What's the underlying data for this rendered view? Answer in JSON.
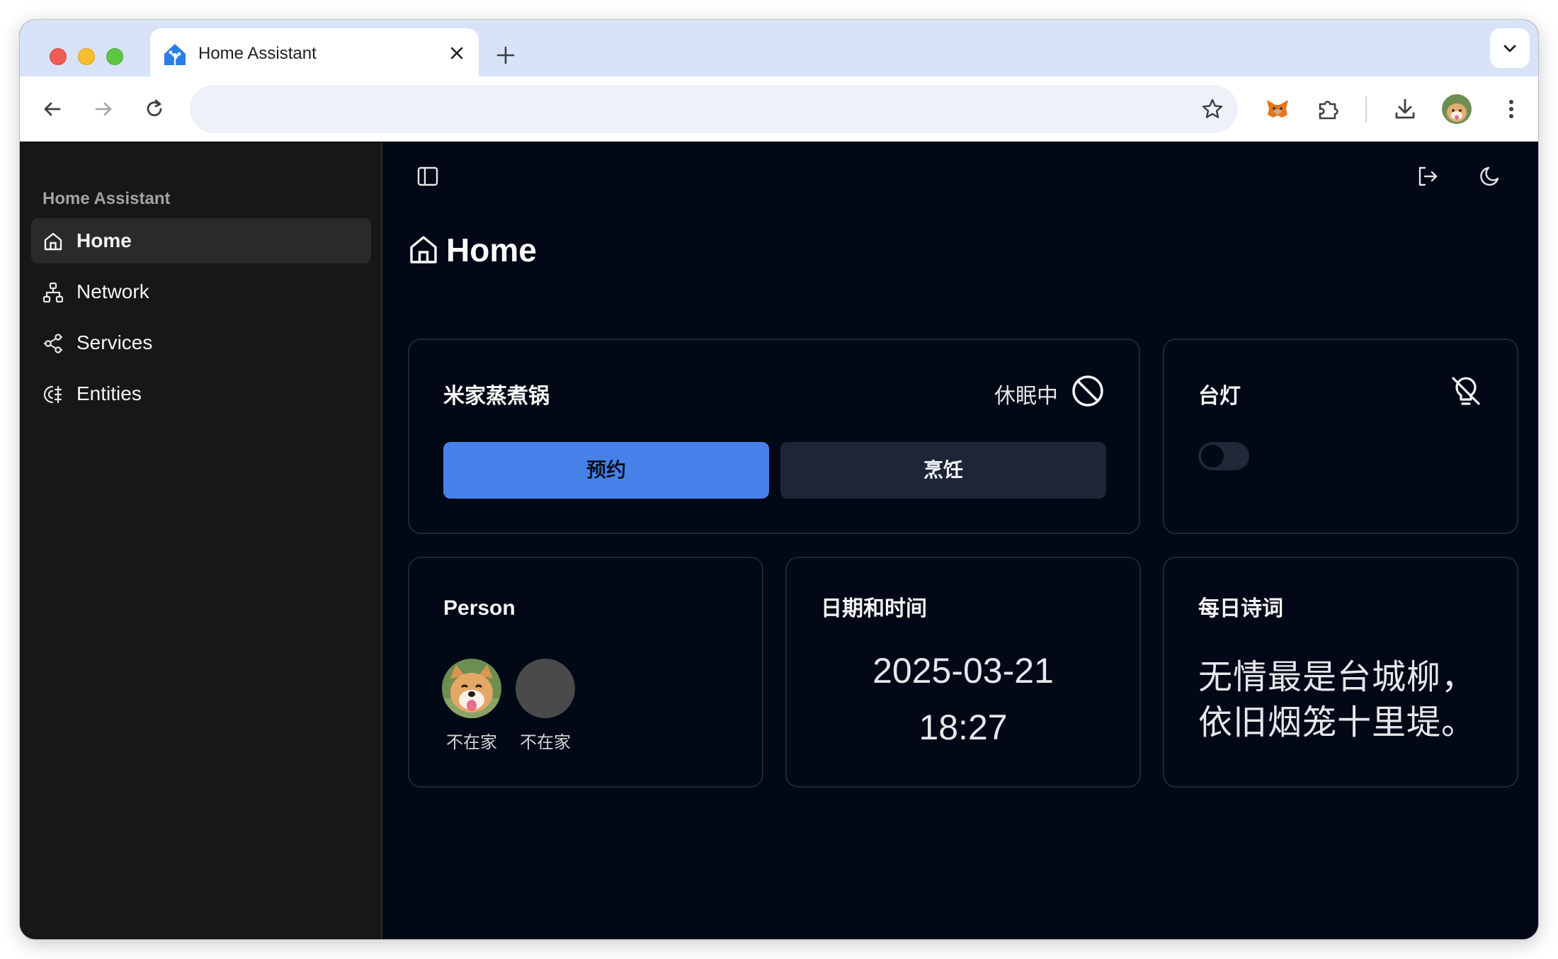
{
  "browser": {
    "tab_title": "Home Assistant",
    "address": ""
  },
  "sidebar": {
    "title": "Home Assistant",
    "items": [
      {
        "label": "Home",
        "icon": "home-icon",
        "active": true
      },
      {
        "label": "Network",
        "icon": "network-icon",
        "active": false
      },
      {
        "label": "Services",
        "icon": "services-icon",
        "active": false
      },
      {
        "label": "Entities",
        "icon": "entities-icon",
        "active": false
      }
    ]
  },
  "page": {
    "title": "Home"
  },
  "cards": {
    "cooker": {
      "title": "米家蒸煮锅",
      "status": "休眠中",
      "button_schedule": "预约",
      "button_cook": "烹饪"
    },
    "lamp": {
      "title": "台灯",
      "toggle_on": false
    },
    "person": {
      "title": "Person",
      "people": [
        {
          "status": "不在家"
        },
        {
          "status": "不在家"
        }
      ]
    },
    "datetime": {
      "title": "日期和时间",
      "date": "2025-03-21",
      "time": "18:27"
    },
    "poem": {
      "title": "每日诗词",
      "line1": "无情最是台城柳，",
      "line2": "依旧烟笼十里堤。"
    }
  },
  "colors": {
    "primary_button": "#4682ea",
    "sidebar_bg": "#171717",
    "main_bg": "#030817"
  }
}
